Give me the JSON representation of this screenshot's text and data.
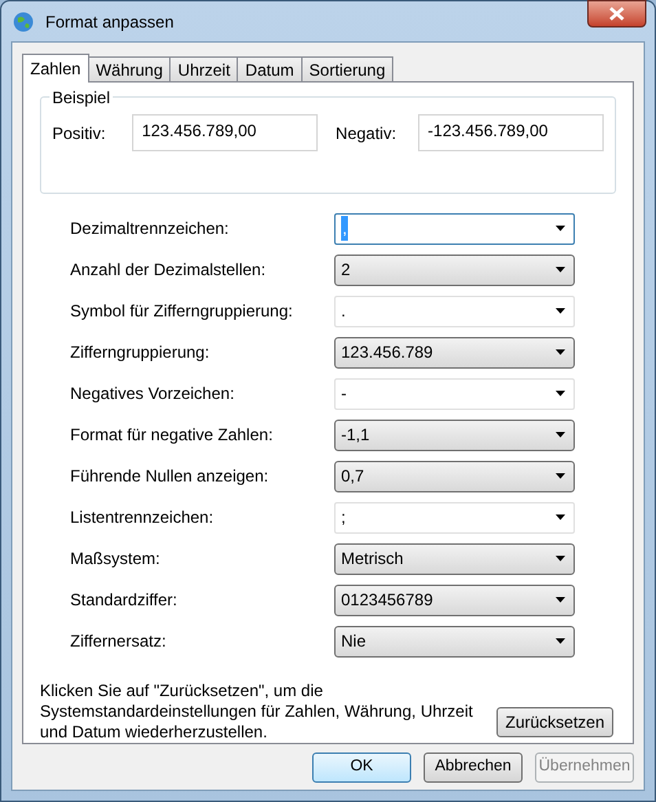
{
  "window": {
    "title": "Format anpassen"
  },
  "tabs": [
    {
      "label": "Zahlen",
      "selected": true
    },
    {
      "label": "Währung",
      "selected": false
    },
    {
      "label": "Uhrzeit",
      "selected": false
    },
    {
      "label": "Datum",
      "selected": false
    },
    {
      "label": "Sortierung",
      "selected": false
    }
  ],
  "example": {
    "title": "Beispiel",
    "positive_label": "Positiv:",
    "positive_value": "123.456.789,00",
    "negative_label": "Negativ:",
    "negative_value": "-123.456.789,00"
  },
  "settings": [
    {
      "label": "Dezimaltrennzeichen:",
      "value": ",",
      "kind": "editable",
      "focused": true
    },
    {
      "label": "Anzahl der Dezimalstellen:",
      "value": "2",
      "kind": "dropdown",
      "focused": false
    },
    {
      "label": "Symbol für Zifferngruppierung:",
      "value": ".",
      "kind": "editable",
      "focused": false
    },
    {
      "label": "Zifferngruppierung:",
      "value": "123.456.789",
      "kind": "dropdown",
      "focused": false
    },
    {
      "label": "Negatives Vorzeichen:",
      "value": "-",
      "kind": "editable",
      "focused": false
    },
    {
      "label": "Format für negative Zahlen:",
      "value": "-1,1",
      "kind": "dropdown",
      "focused": false
    },
    {
      "label": "Führende Nullen anzeigen:",
      "value": "0,7",
      "kind": "dropdown",
      "focused": false
    },
    {
      "label": "Listentrennzeichen:",
      "value": ";",
      "kind": "editable",
      "focused": false
    },
    {
      "label": "Maßsystem:",
      "value": "Metrisch",
      "kind": "dropdown",
      "focused": false
    },
    {
      "label": "Standardziffer:",
      "value": "0123456789",
      "kind": "dropdown",
      "focused": false
    },
    {
      "label": "Ziffernersatz:",
      "value": "Nie",
      "kind": "dropdown",
      "focused": false
    }
  ],
  "reset": {
    "text": "Klicken Sie auf \"Zurücksetzen\", um die Systemstandardeinstellungen für Zahlen, Währung, Uhrzeit und Datum wiederherzustellen.",
    "button": "Zurücksetzen"
  },
  "buttons": [
    {
      "label": "OK",
      "default": true,
      "disabled": false
    },
    {
      "label": "Abbrechen",
      "default": false,
      "disabled": false
    },
    {
      "label": "Übernehmen",
      "default": false,
      "disabled": true
    }
  ]
}
